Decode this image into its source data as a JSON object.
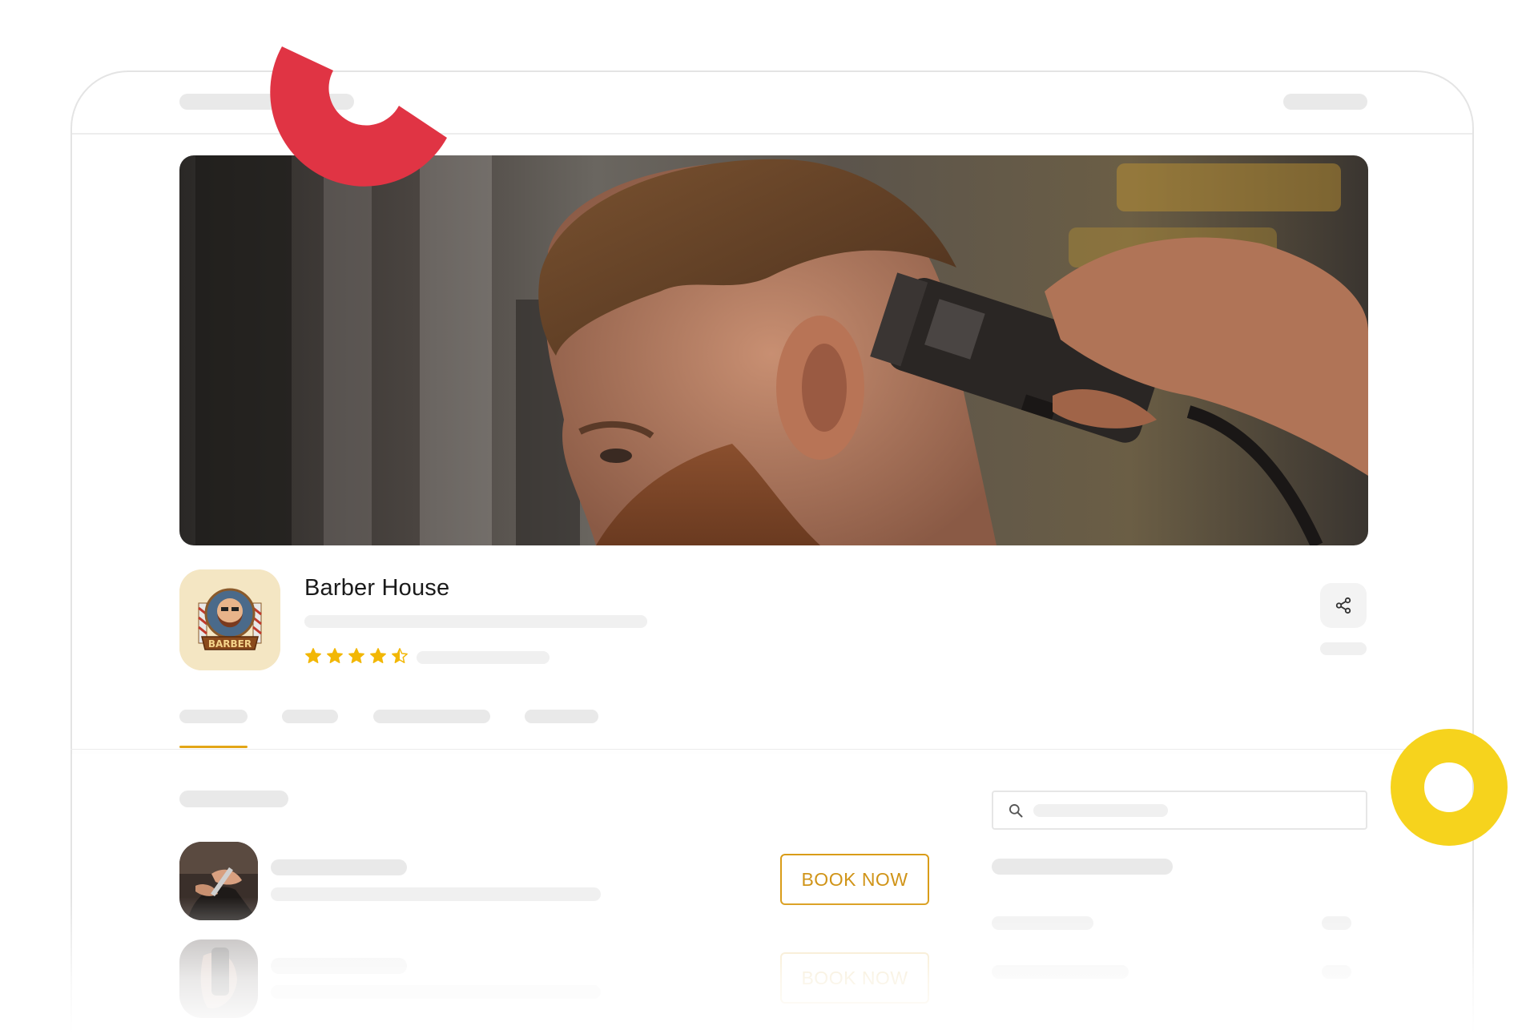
{
  "business": {
    "name": "Barber House",
    "logo_text": "BARBER",
    "rating": 4.5,
    "rating_max": 5
  },
  "actions": {
    "share_icon": "share-icon"
  },
  "services": [
    {
      "book_label": "BOOK NOW"
    },
    {
      "book_label": "BOOK NOW"
    }
  ],
  "search": {
    "icon": "search-icon"
  },
  "colors": {
    "accent": "#d99c18",
    "star": "#f2b705",
    "deco_red": "#e03444",
    "deco_yellow": "#f6d31d",
    "skeleton": "#e9e9e9"
  }
}
